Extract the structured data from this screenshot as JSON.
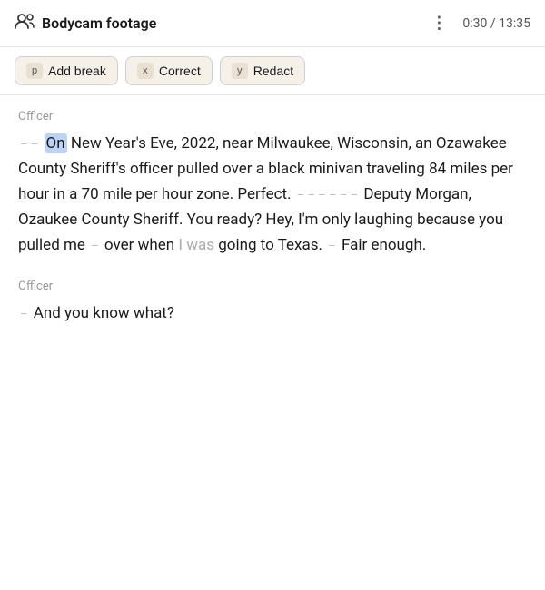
{
  "header": {
    "icon": "👥",
    "title": "Bodycam footage",
    "menu": "⋮",
    "time": "0:30 / 13:35"
  },
  "toolbar": {
    "buttons": [
      {
        "key": "p",
        "label": "Add break"
      },
      {
        "key": "x",
        "label": "Correct"
      },
      {
        "key": "y",
        "label": "Redact"
      }
    ]
  },
  "transcript": [
    {
      "speaker": "Officer",
      "segments": [
        {
          "type": "dash",
          "text": "– –"
        },
        {
          "type": "highlight",
          "text": "On"
        },
        {
          "type": "normal",
          "text": " New Year's Eve, 2022, near Milwaukee, Wisconsin, an Ozawakee County Sheriff's officer pulled over a black minivan traveling 84 miles per hour in a 70 mile per hour zone. Perfect."
        },
        {
          "type": "dash",
          "text": "– – – – – –"
        },
        {
          "type": "normal",
          "text": " Deputy Morgan, Ozaukee County Sheriff. You ready? Hey, I'm only laughing because you pulled me"
        },
        {
          "type": "dash",
          "text": "–"
        },
        {
          "type": "normal",
          "text": " over when "
        },
        {
          "type": "low",
          "text": "I was"
        },
        {
          "type": "normal",
          "text": " going to Texas."
        },
        {
          "type": "dash",
          "text": "–"
        },
        {
          "type": "normal",
          "text": " Fair enough."
        }
      ]
    },
    {
      "speaker": "Officer",
      "segments": [
        {
          "type": "dash",
          "text": "–"
        },
        {
          "type": "normal",
          "text": " And you know what?"
        }
      ]
    }
  ]
}
